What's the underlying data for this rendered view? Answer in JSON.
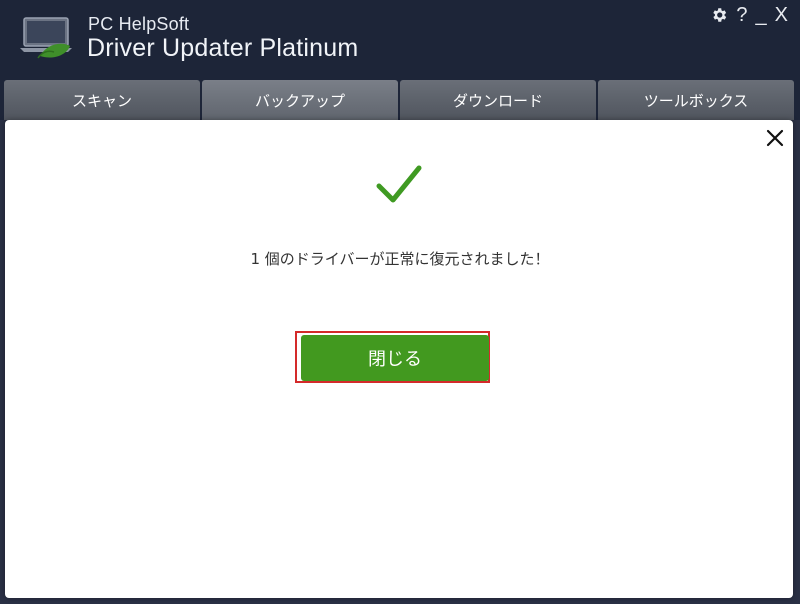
{
  "app": {
    "brand_top": "PC HelpSoft",
    "brand_main": "Driver Updater Platinum",
    "controls": {
      "help": "?",
      "minimize": "_",
      "close": "X"
    }
  },
  "tabs": [
    {
      "label": "スキャン"
    },
    {
      "label": "バックアップ"
    },
    {
      "label": "ダウンロード"
    },
    {
      "label": "ツールボックス"
    }
  ],
  "dialog": {
    "message": "1 個のドライバーが正常に復元されました！",
    "close_button": "閉じる",
    "icon": "check-icon"
  },
  "colors": {
    "accent": "#42991f",
    "highlight": "#d42a2a",
    "background": "#1d2538"
  }
}
